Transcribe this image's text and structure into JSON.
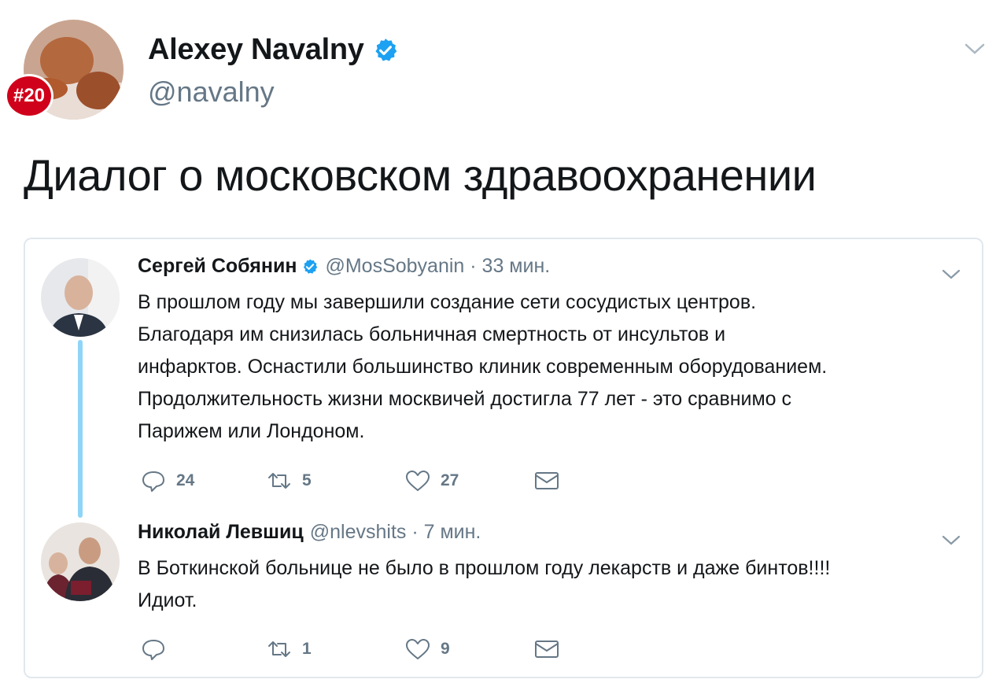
{
  "tweet": {
    "author_name": "Alexey Navalny",
    "author_handle": "@navalny",
    "avatar_badge": "#20",
    "text": "Диалог о московском здравоохранении"
  },
  "quoted_thread": [
    {
      "name": "Сергей Собянин",
      "verified": true,
      "meta": "@MosSobyanin · 33 мин.",
      "lines": [
        "В прошлом году мы завершили создание сети сосудистых центров.",
        "Благодаря им снизилась больничная смертность от инсультов и",
        "инфарктов. Оснастили большинство клиник современным оборудованием.",
        "Продолжительность жизни москвичей достигла 77 лет - это сравнимо с",
        "Парижем или Лондоном."
      ],
      "replies": "24",
      "retweets": "5",
      "likes": "27"
    },
    {
      "name": "Николай Левшиц",
      "verified": false,
      "meta": "@nlevshits · 7 мин.",
      "lines": [
        "В Боткинской больнице не было в прошлом году лекарств и даже бинтов!!!!",
        "Идиот."
      ],
      "replies": "",
      "retweets": "1",
      "likes": "9"
    }
  ],
  "colors": {
    "verified_blue": "#1da1f2",
    "thread_line": "#8fd5f7",
    "secondary_text": "#657786",
    "badge_red": "#d0021b"
  }
}
